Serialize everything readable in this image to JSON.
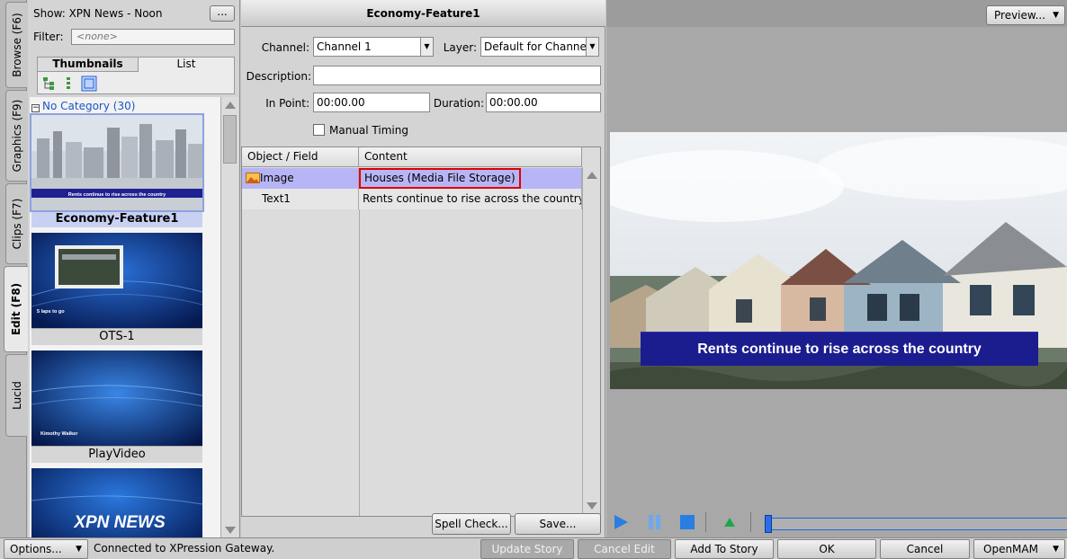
{
  "tabs": [
    {
      "label": "Browse (F6)",
      "active": false
    },
    {
      "label": "Graphics (F9)",
      "active": false
    },
    {
      "label": "Clips (F7)",
      "active": false
    },
    {
      "label": "Edit (F8)",
      "active": true
    },
    {
      "label": "Lucid",
      "active": false
    }
  ],
  "browse": {
    "show_label": "Show: XPN News - Noon",
    "more_button": "...",
    "filter_label": "Filter:",
    "filter_value": "<none>",
    "view_tabs": [
      "Thumbnails",
      "List"
    ],
    "category": "No Category (30)",
    "category_toggle": "−",
    "thumbnails": [
      {
        "title": "Economy-Feature1",
        "caption_text": "Rents continue to rise across the country",
        "selected": true
      },
      {
        "title": "OTS-1",
        "caption_text": "5 laps to go",
        "selected": false
      },
      {
        "title": "PlayVideo",
        "caption_text": "Kimothy Walker",
        "selected": false
      },
      {
        "title": "",
        "caption_text": "XPN NEWS",
        "selected": false
      }
    ]
  },
  "editor": {
    "title": "Economy-Feature1",
    "channel_label": "Channel:",
    "channel_value": "Channel 1",
    "layer_label": "Layer:",
    "layer_value": "Default for Channe",
    "description_label": "Description:",
    "description_value": "",
    "inpoint_label": "In Point:",
    "inpoint_value": "00:00.00",
    "duration_label": "Duration:",
    "duration_value": "00:00.00",
    "manual_timing_label": "Manual Timing",
    "grid": {
      "headers": [
        "Object / Field",
        "Content"
      ],
      "rows": [
        {
          "field": "Image",
          "content": "Houses (Media File Storage)",
          "has_icon": true,
          "selected": true
        },
        {
          "field": "Text1",
          "content": "Rents continue to rise across the country",
          "has_icon": false,
          "selected": false
        }
      ]
    },
    "spellcheck_button": "Spell Check...",
    "save_button": "Save..."
  },
  "preview": {
    "button": "Preview...",
    "lower_third_text": "Rents continue to rise across the country",
    "timeline_position": 0.0
  },
  "statusbar": {
    "options_button": "Options...",
    "status_text": "Connected to XPression Gateway.",
    "update_story": "Update Story",
    "cancel_edit": "Cancel Edit",
    "add_to_story": "Add To Story",
    "ok": "OK",
    "cancel": "Cancel",
    "openmam": "OpenMAM"
  },
  "colors": {
    "selection": "#b7b5f5",
    "lower_third": "#1b1d8f",
    "highlight_border": "#e00000",
    "transport_blue": "#2a7de1",
    "transport_green": "#1fa64a"
  }
}
